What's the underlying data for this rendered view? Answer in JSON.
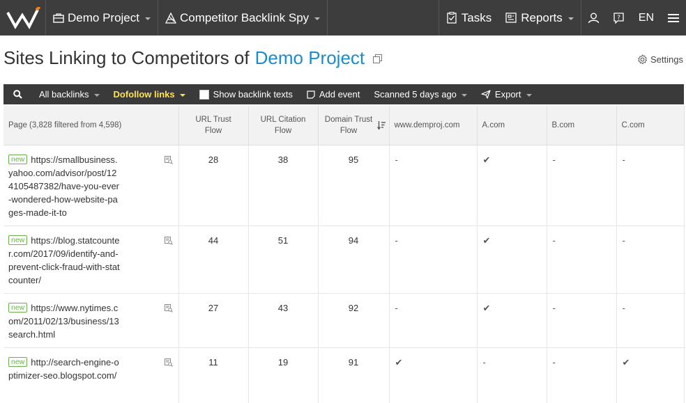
{
  "topbar": {
    "project_label": "Demo Project",
    "tool_label": "Competitor Backlink Spy",
    "tasks_label": "Tasks",
    "reports_label": "Reports",
    "lang_label": "EN"
  },
  "header": {
    "title_prefix": "Sites Linking to Competitors of",
    "title_project": "Demo Project",
    "settings_label": "Settings"
  },
  "toolbar": {
    "all_backlinks": "All backlinks",
    "dofollow": "Dofollow links",
    "show_texts": "Show backlink texts",
    "add_event": "Add event",
    "scanned": "Scanned 5 days ago",
    "export": "Export"
  },
  "table": {
    "headers": {
      "page": "Page (3,828 filtered from 4,598)",
      "url_trust": "URL Trust Flow",
      "url_citation": "URL Citation Flow",
      "domain_trust": "Domain Trust Flow",
      "c1": "www.demproj.com",
      "c2": "A.com",
      "c3": "B.com",
      "c4": "C.com"
    },
    "badge": "new",
    "rows": [
      {
        "url": "https://smallbusiness.yahoo.com/advisor/post/124105487382/have-you-ever-wondered-how-website-pages-made-it-to",
        "utf": "28",
        "ucf": "38",
        "dtf": "95",
        "c1": "-",
        "c2": "✔",
        "c3": "-",
        "c4": "-"
      },
      {
        "url": "https://blog.statcounter.com/2017/09/identify-and-prevent-click-fraud-with-statcounter/",
        "utf": "44",
        "ucf": "51",
        "dtf": "94",
        "c1": "-",
        "c2": "✔",
        "c3": "-",
        "c4": "-"
      },
      {
        "url": "https://www.nytimes.com/2011/02/13/business/13search.html",
        "utf": "27",
        "ucf": "43",
        "dtf": "92",
        "c1": "-",
        "c2": "✔",
        "c3": "-",
        "c4": "-"
      },
      {
        "url": "http://search-engine-optimizer-seo.blogspot.com/",
        "utf": "11",
        "ucf": "19",
        "dtf": "91",
        "c1": "✔",
        "c2": "-",
        "c3": "-",
        "c4": "✔"
      }
    ]
  }
}
